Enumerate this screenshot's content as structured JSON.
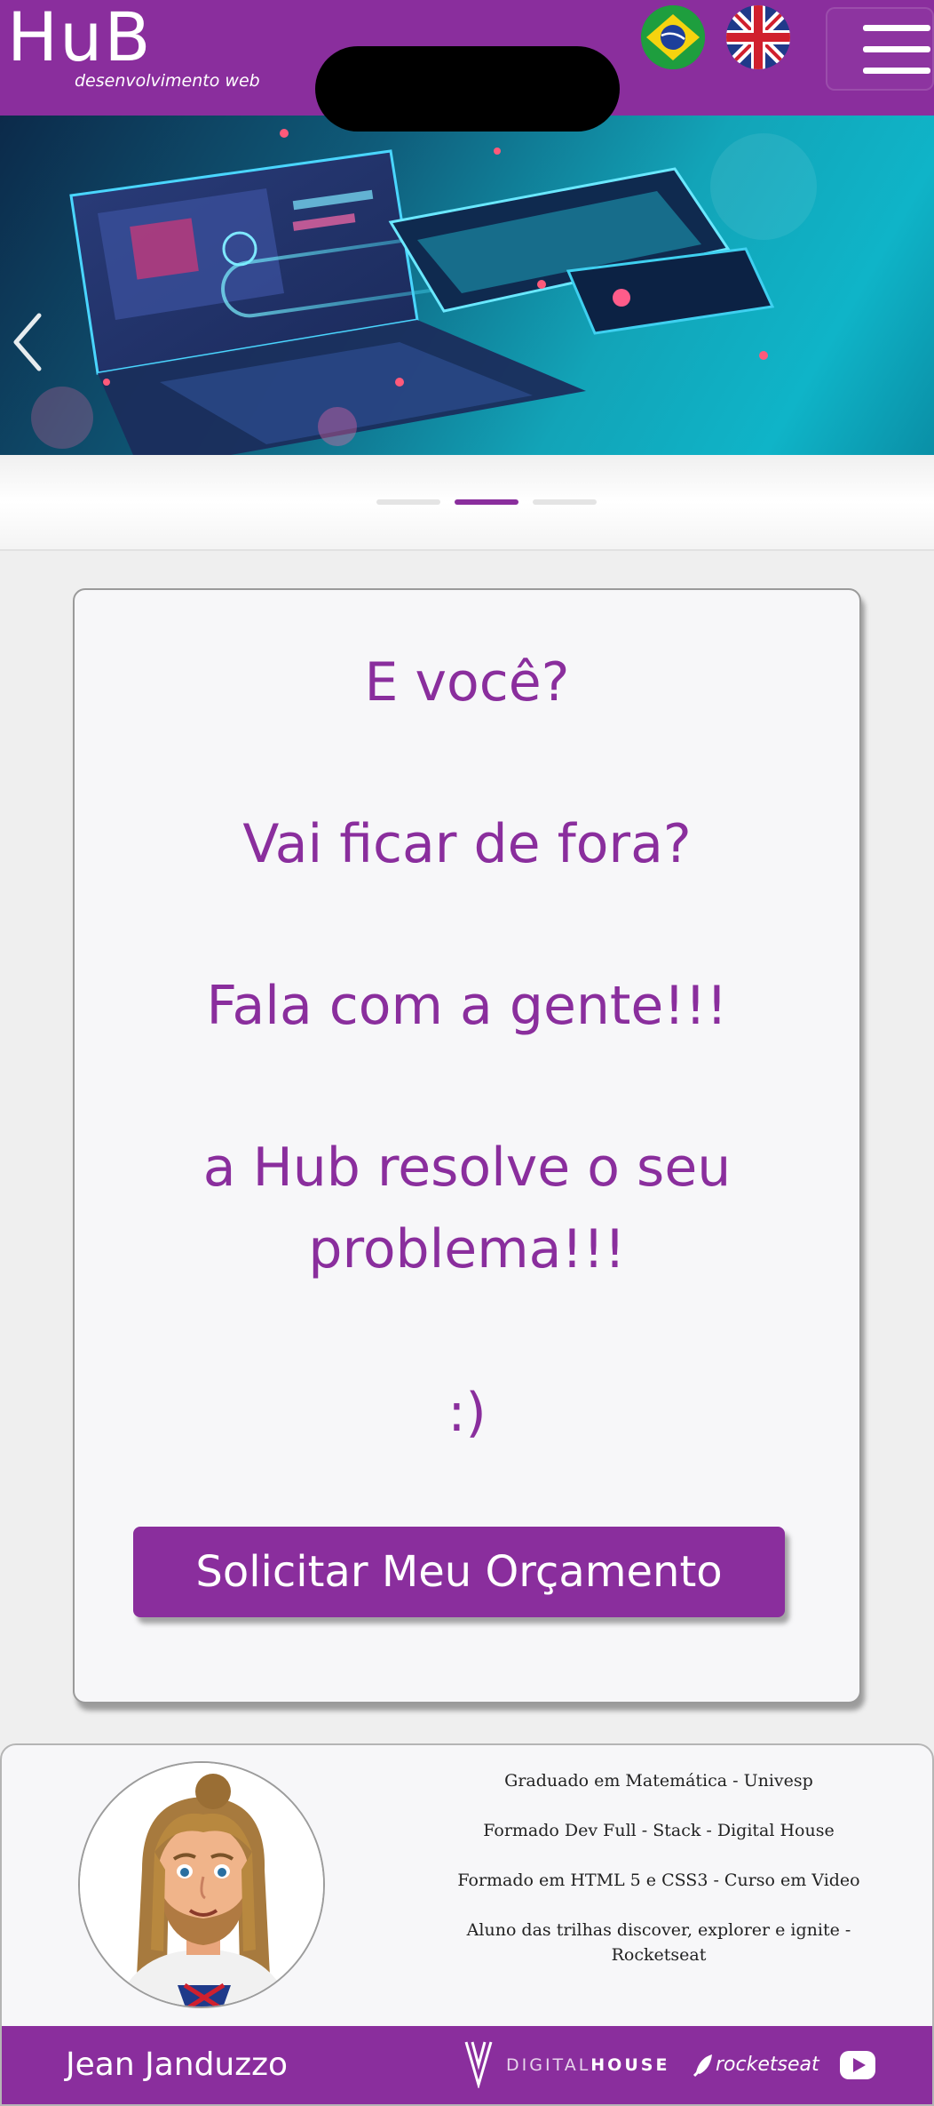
{
  "header": {
    "logo": "HuB",
    "logo_subtitle": "desenvolvimento web",
    "languages": [
      {
        "name": "flag-brazil-icon"
      },
      {
        "name": "flag-uk-icon"
      }
    ],
    "menu_icon": "hamburger-menu-icon"
  },
  "carousel": {
    "prev_icon": "chevron-left-icon",
    "slide_count": 3,
    "active_slide": 2
  },
  "card": {
    "lines": [
      "E você?",
      "Vai ficar de fora?",
      "Fala com a gente!!!",
      "a Hub resolve o seu",
      "problema!!!",
      ":)"
    ],
    "cta_label": "Solicitar Meu Orçamento"
  },
  "profile": {
    "bio": [
      "Graduado em Matemática - Univesp",
      "Formado Dev Full - Stack - Digital House",
      "Formado em HTML 5 e CSS3 - Curso em Video",
      "Aluno das trilhas discover, explorer e ignite - Rocketseat"
    ],
    "name": "Jean Janduzzo",
    "partners": {
      "digitalhouse_light": "DIGITAL",
      "digitalhouse_bold": "HOUSE",
      "rocketseat": "rocketseat"
    }
  },
  "colors": {
    "brand": "#8a2e9d",
    "card_bg": "#f7f7f9",
    "banner_accent": "#12a4b8"
  }
}
